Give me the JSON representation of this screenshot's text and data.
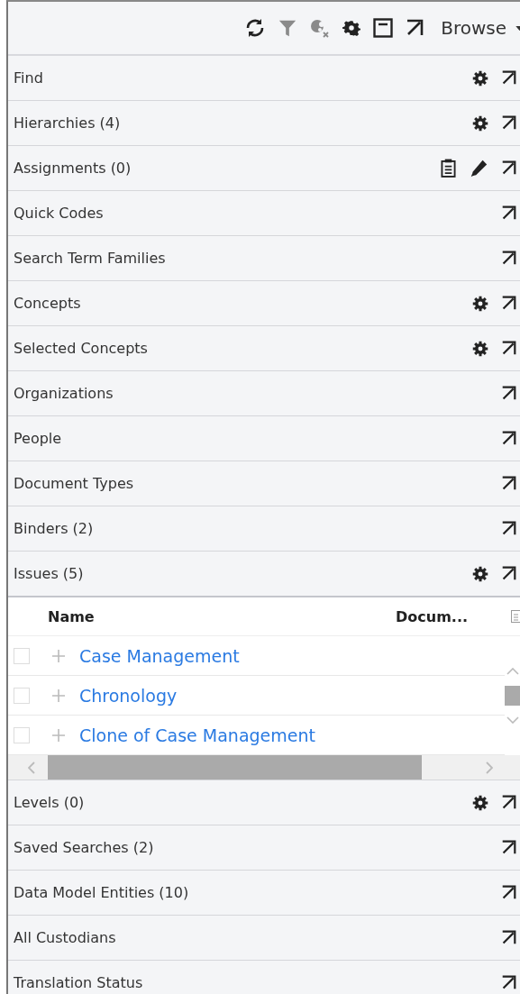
{
  "toolbar": {
    "tools": [
      {
        "kind": "refresh",
        "disabled": false
      },
      {
        "kind": "filter",
        "disabled": true
      },
      {
        "kind": "clear",
        "disabled": true
      },
      {
        "kind": "gear",
        "disabled": false
      },
      {
        "kind": "panel",
        "disabled": false
      },
      {
        "kind": "popout",
        "disabled": false
      }
    ],
    "view_menu": "Browse"
  },
  "sections": [
    {
      "title": "Find",
      "icons": [
        {
          "kind": "gear"
        },
        {
          "kind": "popout"
        }
      ]
    },
    {
      "title": "Hierarchies (4)",
      "icons": [
        {
          "kind": "gear"
        },
        {
          "kind": "popout"
        }
      ]
    },
    {
      "title": "Assignments (0)",
      "icons": [
        {
          "kind": "clipboard"
        },
        {
          "kind": "pencil"
        },
        {
          "kind": "popout"
        }
      ]
    },
    {
      "title": "Quick Codes",
      "icons": [
        {
          "kind": "popout"
        }
      ]
    },
    {
      "title": "Search Term Families",
      "icons": [
        {
          "kind": "popout"
        }
      ]
    },
    {
      "title": "Concepts",
      "icons": [
        {
          "kind": "gear"
        },
        {
          "kind": "popout"
        }
      ]
    },
    {
      "title": "Selected Concepts",
      "icons": [
        {
          "kind": "gear"
        },
        {
          "kind": "popout"
        }
      ]
    },
    {
      "title": "Organizations",
      "icons": [
        {
          "kind": "popout"
        }
      ]
    },
    {
      "title": "People",
      "icons": [
        {
          "kind": "popout"
        }
      ]
    },
    {
      "title": "Document Types",
      "icons": [
        {
          "kind": "popout"
        }
      ]
    },
    {
      "title": "Binders (2)",
      "icons": [
        {
          "kind": "popout"
        }
      ]
    },
    {
      "title": "Issues (5)",
      "icons": [
        {
          "kind": "gear"
        },
        {
          "kind": "popout"
        }
      ],
      "expanded": true,
      "table": {
        "columns": [
          "Name",
          "Docum..."
        ],
        "rows": [
          {
            "name": "Case Management",
            "checked": false
          },
          {
            "name": "Chronology",
            "checked": false
          },
          {
            "name": "Clone of Case Management",
            "checked": false
          }
        ]
      }
    },
    {
      "title": "Levels (0)",
      "icons": [
        {
          "kind": "gear"
        },
        {
          "kind": "popout"
        }
      ]
    },
    {
      "title": "Saved Searches (2)",
      "icons": [
        {
          "kind": "popout"
        }
      ]
    },
    {
      "title": "Data Model Entities (10)",
      "icons": [
        {
          "kind": "popout"
        }
      ]
    },
    {
      "title": "All Custodians",
      "icons": [
        {
          "kind": "popout"
        }
      ]
    },
    {
      "title": "Translation Status",
      "icons": [
        {
          "kind": "popout"
        }
      ]
    }
  ]
}
